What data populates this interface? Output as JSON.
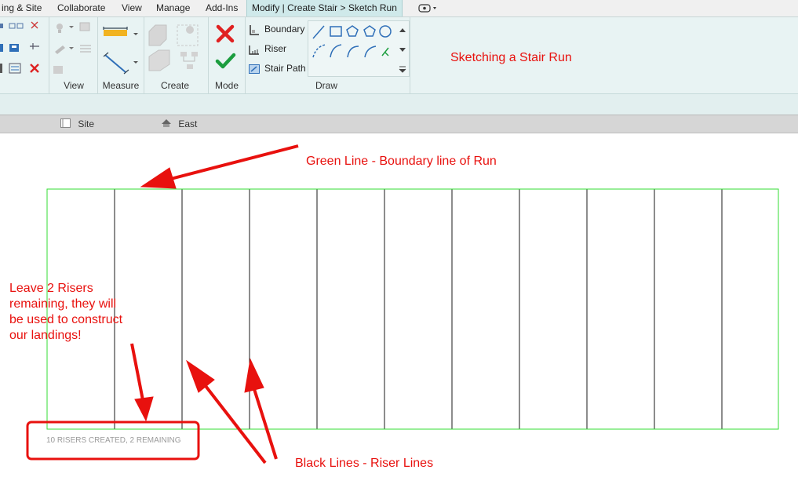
{
  "ribbon_tabs": [
    "ing & Site",
    "Collaborate",
    "View",
    "Manage",
    "Add-Ins",
    "Modify | Create Stair > Sketch Run"
  ],
  "panels": {
    "view": "View",
    "measure": "Measure",
    "create": "Create",
    "mode": "Mode",
    "draw": "Draw"
  },
  "draw_tools": {
    "boundary": "Boundary",
    "riser": "Riser",
    "stair_path": "Stair Path"
  },
  "view_tabs": {
    "site": "Site",
    "east": "East"
  },
  "annotations": {
    "title": "Sketching a Stair Run",
    "green_line": "Green Line - Boundary line of Run",
    "black_lines": "Black Lines - Riser Lines",
    "leave_risers": [
      "Leave 2 Risers",
      "remaining, they will",
      "be used to construct",
      "our landings!"
    ]
  },
  "status_text": "10 RISERS CREATED, 2 REMAINING",
  "colors": {
    "boundary_line": "#33dd33",
    "riser_line": "#1a1a1a",
    "annotation": "#e8110e",
    "active_tab": "#cfe9ea"
  },
  "icons": [
    "cancel-icon",
    "finish-check-icon",
    "boundary-icon",
    "riser-icon",
    "stair-path-icon",
    "line-icon",
    "rectangle-icon",
    "polygon-icon",
    "circle-icon",
    "arc-icon",
    "measure-icon",
    "context-menu-icon"
  ]
}
